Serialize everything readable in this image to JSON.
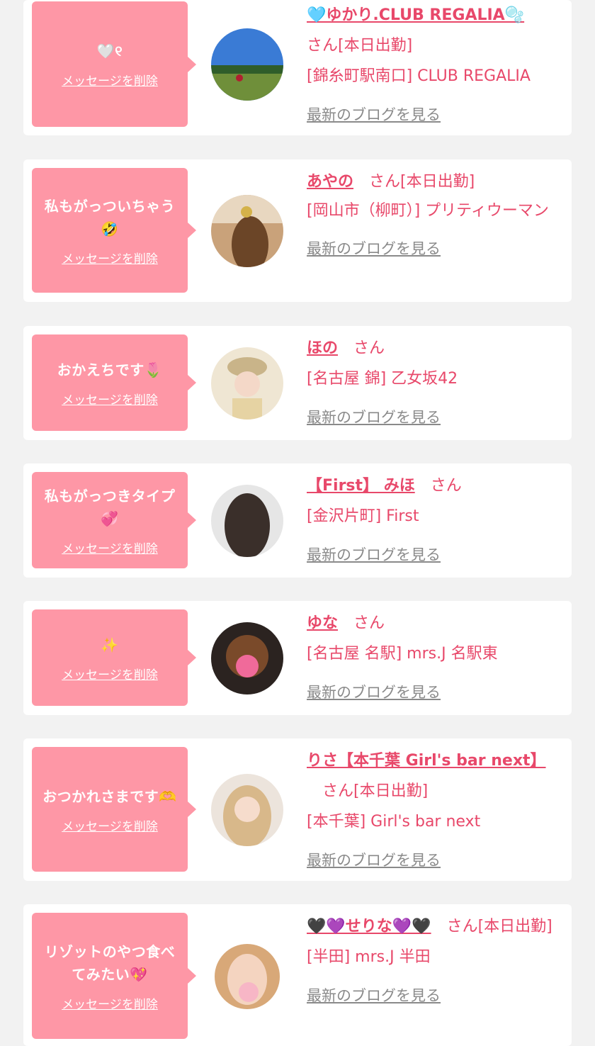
{
  "cards": [
    {
      "message": "🤍୧",
      "delete_label": "メッセージを削除",
      "name": "🩵ゆかり.CLUB REGALIA🫧",
      "san": "さん[本日出勤]",
      "shop": "[錦糸町駅南口] CLUB REGALIA",
      "blog": "最新のブログを見る"
    },
    {
      "message": "私もがっついちゃう🤣",
      "delete_label": "メッセージを削除",
      "name": "あやの",
      "san": "さん[本日出勤]",
      "shop": "[岡山市（柳町）] プリティウーマン",
      "blog": "最新のブログを見る"
    },
    {
      "message": "おかえちです🌷",
      "delete_label": "メッセージを削除",
      "name": "ほの",
      "san": "さん",
      "shop": "[名古屋 錦] 乙女坂42",
      "blog": "最新のブログを見る"
    },
    {
      "message": "私もがっつきタイプ💞",
      "delete_label": "メッセージを削除",
      "name": "【First】 みほ",
      "san": "さん",
      "shop": "[金沢片町] First",
      "blog": "最新のブログを見る"
    },
    {
      "message": "✨",
      "delete_label": "メッセージを削除",
      "name": "ゆな",
      "san": "さん",
      "shop": "[名古屋 名駅] mrs.J 名駅東",
      "blog": "最新のブログを見る"
    },
    {
      "message": "おつかれさまです🫶",
      "delete_label": "メッセージを削除",
      "name": "りさ【本千葉 Girl's bar next】",
      "san": "さん[本日出勤]",
      "shop": "[本千葉] Girl's bar next",
      "blog": "最新のブログを見る"
    },
    {
      "message": "リゾットのやつ食べてみたい💖",
      "delete_label": "メッセージを削除",
      "name": "🖤💜せりな💜🖤",
      "san": "さん[本日出勤]",
      "shop": "[半田] mrs.J 半田",
      "blog": "最新のブログを見る"
    }
  ],
  "colors": {
    "bubble": "#fe97a6",
    "name": "#e8486a",
    "blog": "#8a8a8a",
    "background": "#f2f2f2"
  }
}
